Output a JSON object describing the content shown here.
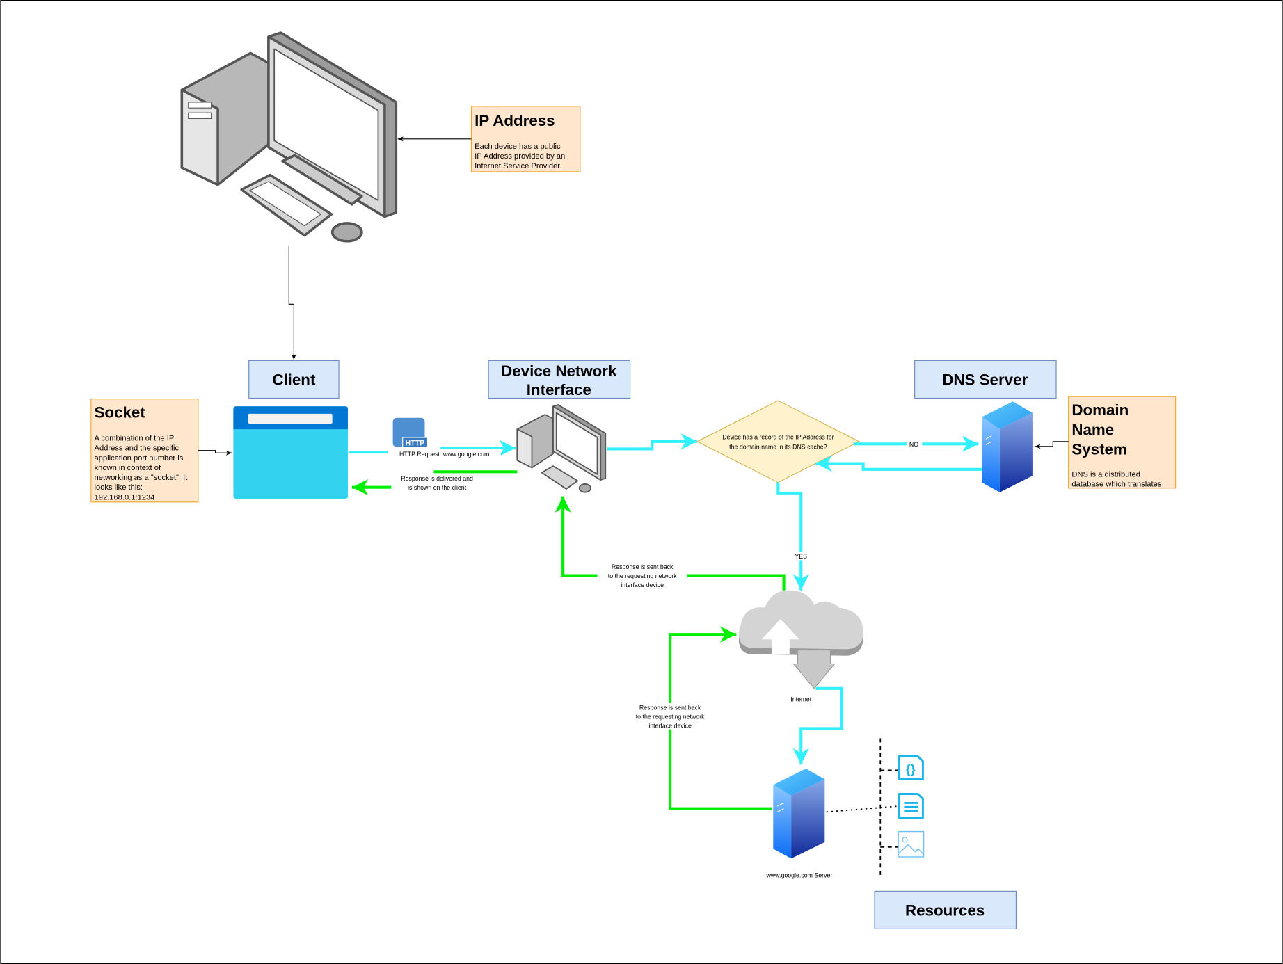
{
  "labels": {
    "client": "Client",
    "device_network_interface": [
      "Device Network",
      "Interface"
    ],
    "dns_server": "DNS Server",
    "resources": "Resources"
  },
  "notes": {
    "ip_address": {
      "title": "IP Address",
      "body": [
        "Each device has a public",
        "IP Address provided by an",
        "Internet Service Provider."
      ]
    },
    "socket": {
      "title": "Socket",
      "body": [
        "A combination of the IP",
        "Address and the specific",
        "application port number is",
        "known in context of",
        "networking as a \"socket\". It",
        "looks like this:",
        "192.168.0.1:1234"
      ]
    },
    "dns": {
      "title": [
        "Domain",
        "Name",
        "System"
      ],
      "body": [
        "DNS is a distributed",
        "database which translates"
      ]
    }
  },
  "edges": {
    "http_request": "HTTP Request: www.google.com",
    "response_delivered": [
      "Response is delivered and",
      "is shown on the client"
    ],
    "decision": [
      "Device has a record of the IP Address for",
      "the domain name in its DNS cache?"
    ],
    "no": "NO",
    "yes": "YES",
    "internet": "Internet",
    "response_sent_1": [
      "Response is sent back",
      "to the requesting network",
      "interface device"
    ],
    "response_sent_2": [
      "Response is sent back",
      "to the requesting network",
      "interface device"
    ],
    "google_server": "www.google.com Server",
    "http_badge": "HTTP"
  },
  "colors": {
    "request": "#33f0ff",
    "response": "#00ff00",
    "label_fill": "#dae8fc",
    "note_fill": "#ffe6cc"
  }
}
